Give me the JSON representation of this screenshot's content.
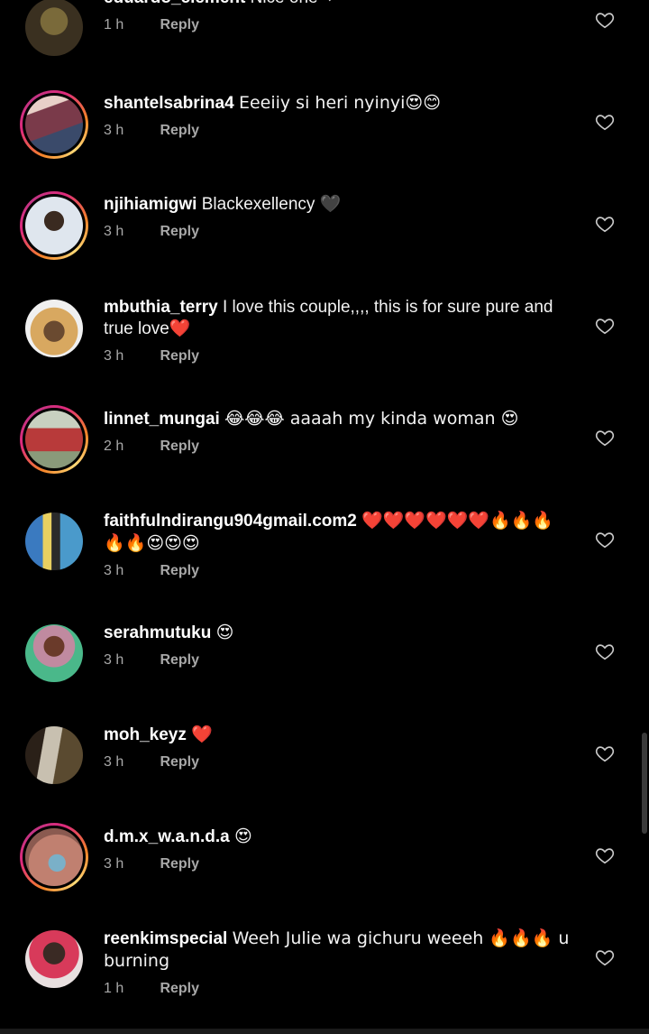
{
  "comments": [
    {
      "username": "eduardo_clement",
      "text": "Nice one ❤",
      "time": "1 h",
      "reply": "Reply",
      "ring": false,
      "avatar_color": "#5a4a2a"
    },
    {
      "username": "shantelsabrina4",
      "text": "Eeeiiy si heri nyinyi😍😊",
      "time": "3 h",
      "reply": "Reply",
      "ring": true,
      "avatar_color": "#6b4a5a"
    },
    {
      "username": "njihiamigwi",
      "text": "Blackexellency 🖤",
      "time": "3 h",
      "reply": "Reply",
      "ring": true,
      "avatar_color": "#dfe6ee"
    },
    {
      "username": "mbuthia_terry",
      "text": "I love this couple,,,, this is for sure pure and true love❤️",
      "time": "3 h",
      "reply": "Reply",
      "ring": false,
      "avatar_color": "#c9a06a"
    },
    {
      "username": "linnet_mungai",
      "text": "😂😂😂 aaaah my kinda woman 😍",
      "time": "2 h",
      "reply": "Reply",
      "ring": true,
      "avatar_color": "#b8c0a8"
    },
    {
      "username": "faithfulndirangu904gmail.com2",
      "text": "❤️❤️❤️❤️❤️❤️🔥🔥🔥🔥🔥😍😍😍",
      "time": "3 h",
      "reply": "Reply",
      "ring": false,
      "avatar_color": "#4a9acb"
    },
    {
      "username": "serahmutuku",
      "text": "😍",
      "time": "3 h",
      "reply": "Reply",
      "ring": false,
      "avatar_color": "#7a9a8a"
    },
    {
      "username": "moh_keyz",
      "text": "❤️",
      "time": "3 h",
      "reply": "Reply",
      "ring": false,
      "avatar_color": "#4a3a2a"
    },
    {
      "username": "d.m.x_w.a.n.d.a",
      "text": "😍",
      "time": "3 h",
      "reply": "Reply",
      "ring": true,
      "avatar_color": "#b0706a"
    },
    {
      "username": "reenkimspecial",
      "text": "Weeh Julie wa gichuru weeeh 🔥🔥🔥 u burning",
      "time": "1 h",
      "reply": "Reply",
      "ring": false,
      "avatar_color": "#9a6a7a"
    }
  ],
  "icons": {
    "like": "heart-outline-icon"
  },
  "colors": {
    "background": "#000000",
    "username": "#ffffff",
    "text": "#f2f2f2",
    "meta": "#a8a8a8",
    "heart": "#c8c8c8"
  }
}
